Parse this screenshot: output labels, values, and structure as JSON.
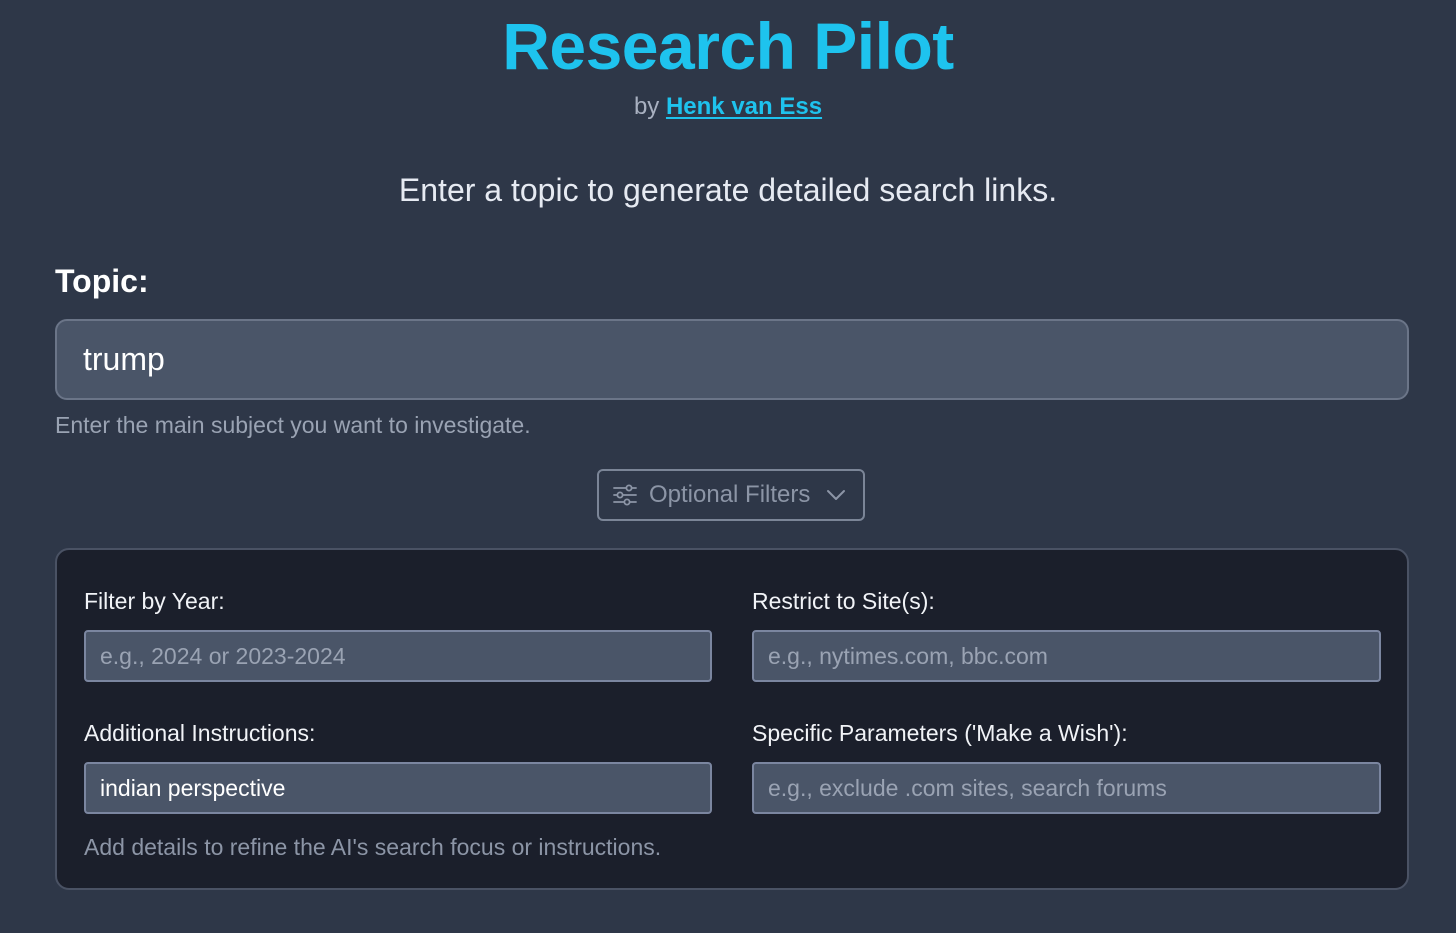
{
  "header": {
    "title": "Research Pilot",
    "by_prefix": "by",
    "author": "Henk van Ess",
    "subtitle": "Enter a topic to generate detailed search links."
  },
  "topic": {
    "label": "Topic:",
    "value": "trump",
    "help": "Enter the main subject you want to investigate."
  },
  "filters_toggle": {
    "label": "Optional Filters",
    "icon": "sliders-icon",
    "chevron": "chevron-down-icon"
  },
  "filters": {
    "year": {
      "label": "Filter by Year:",
      "placeholder": "e.g., 2024 or 2023-2024",
      "value": ""
    },
    "sites": {
      "label": "Restrict to Site(s):",
      "placeholder": "e.g., nytimes.com, bbc.com",
      "value": ""
    },
    "instructions": {
      "label": "Additional Instructions:",
      "placeholder": "",
      "value": "indian perspective",
      "help": "Add details to refine the AI's search focus or instructions."
    },
    "params": {
      "label": "Specific Parameters ('Make a Wish'):",
      "placeholder": "e.g., exclude .com sites, search forums",
      "value": ""
    }
  },
  "colors": {
    "background": "#2e3748",
    "accent": "#1ec3ee",
    "panel": "#1b1f2b",
    "input": "#4a5568"
  }
}
